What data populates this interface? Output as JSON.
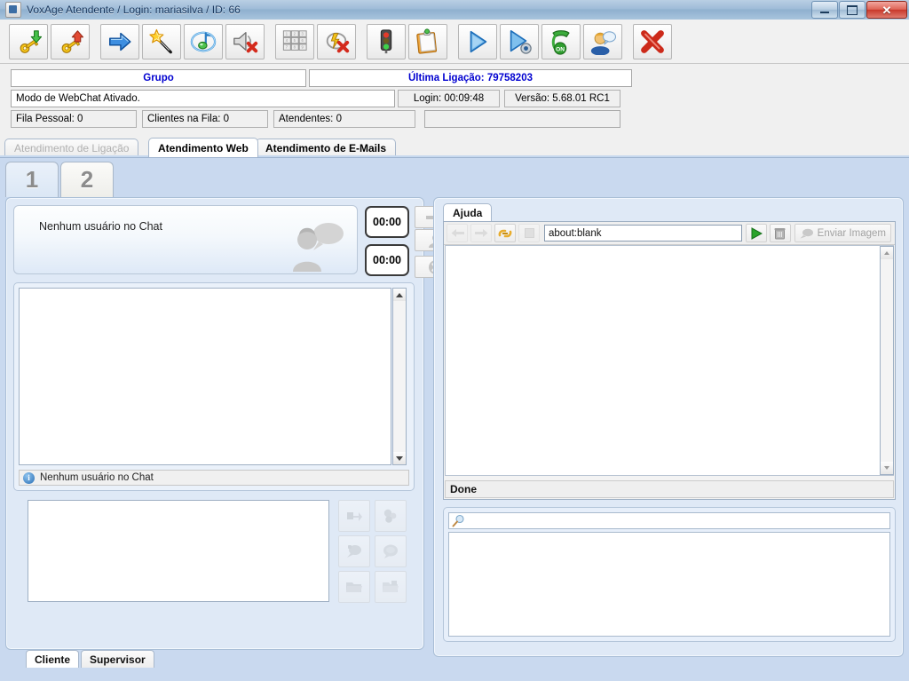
{
  "window": {
    "title": "VoxAge Atendente  /  Login: mariasilva  /  ID: 66",
    "app_icon": "java-coffee-cup-icon",
    "buttons": {
      "minimize": "–",
      "maximize": "□",
      "close": "✕"
    }
  },
  "toolbar": {
    "buttons": [
      {
        "name": "login-key-icon",
        "tip": "Login"
      },
      {
        "name": "logout-key-icon",
        "tip": "Logout"
      },
      {
        "name": "blue-arrow-right-icon",
        "tip": "Avancar"
      },
      {
        "name": "magic-wand-star-icon",
        "tip": "Assistente"
      },
      {
        "name": "music-note-icon",
        "tip": "Audio"
      },
      {
        "name": "speaker-mute-icon",
        "tip": "Mudo"
      },
      {
        "name": "keypad-icon",
        "tip": "Teclado"
      },
      {
        "name": "disconnect-icon",
        "tip": "Desconectar"
      },
      {
        "name": "traffic-light-icon",
        "tip": "Status"
      },
      {
        "name": "clipboard-icon",
        "tip": "Formulario"
      },
      {
        "name": "play-icon",
        "tip": "Iniciar"
      },
      {
        "name": "play-record-icon",
        "tip": "Iniciar Gravacao"
      },
      {
        "name": "phone-on-icon",
        "tip": "Telefone ON"
      },
      {
        "name": "user-chat-icon",
        "tip": "Atendimento"
      },
      {
        "name": "red-x-icon",
        "tip": "Sair"
      }
    ]
  },
  "status": {
    "grupo": "Grupo",
    "ultima_ligacao": "Última Ligação: 79758203",
    "modo": "Modo de WebChat Ativado.",
    "login_timer": "Login: 00:09:48",
    "versao": "Versão: 5.68.01 RC1",
    "fila_pessoal": "Fila Pessoal: 0",
    "clientes_na_fila": "Clientes na Fila: 0",
    "atendentes": "Atendentes: 0",
    "extra": ""
  },
  "tabs": {
    "main": [
      {
        "label": "Atendimento de Ligação",
        "state": "disabled"
      },
      {
        "label": "Atendimento Web",
        "state": "active"
      },
      {
        "label": "Atendimento de E-Mails",
        "state": "normal"
      }
    ],
    "session": [
      {
        "label": "1",
        "state": "selected"
      },
      {
        "label": "2",
        "state": "unselected"
      }
    ]
  },
  "chat": {
    "header_text": "Nenhum usuário no Chat",
    "avatar_icon": "user-speech-bubble-icon",
    "timer_top": "00:00",
    "timer_bottom": "00:00",
    "side_buttons": [
      {
        "name": "transfer-arrow-icon"
      },
      {
        "name": "user-icon"
      },
      {
        "name": "end-chat-icon"
      }
    ],
    "transcript": "",
    "status_line": "Nenhum usuário no Chat",
    "status_icon": "info-icon",
    "composer_value": "",
    "composer_buttons": [
      {
        "name": "send-file-icon"
      },
      {
        "name": "attach-icon"
      },
      {
        "name": "quick-reply-icon"
      },
      {
        "name": "speech-bubble-icon"
      },
      {
        "name": "folder-send-icon"
      },
      {
        "name": "folder-icon"
      }
    ],
    "sub_tabs": [
      {
        "label": "Cliente",
        "state": "selected"
      },
      {
        "label": "Supervisor",
        "state": "unselected"
      }
    ]
  },
  "help": {
    "tab_label": "Ajuda",
    "nav": [
      {
        "name": "back-arrow-icon",
        "enabled": false
      },
      {
        "name": "forward-arrow-icon",
        "enabled": false
      },
      {
        "name": "link-chain-icon",
        "enabled": true
      },
      {
        "name": "stop-icon",
        "enabled": false
      }
    ],
    "url_value": "about:blank",
    "url_placeholder": "about:blank",
    "go_icon": "green-play-icon",
    "trash_icon": "trash-icon",
    "send_image_label": "Enviar Imagem",
    "send_image_icon": "send-image-icon",
    "page_content": "",
    "status_text": "Done"
  },
  "search_panel": {
    "icon": "magnifier-icon",
    "input_value": "",
    "results": ""
  },
  "colors": {
    "content_bg": "#c9d9ef",
    "accent_blue": "#0000d0",
    "pane_border": "#a9bed6",
    "close_red": "#c8372a"
  }
}
